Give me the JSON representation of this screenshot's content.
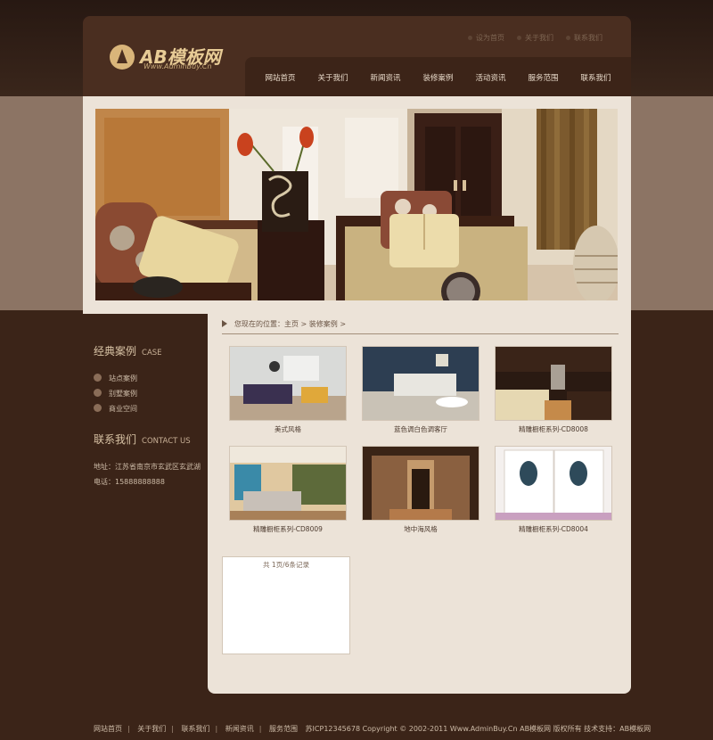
{
  "header": {
    "logo_title": "AB模板网",
    "logo_sub": "Www.AdminBuy.Cn",
    "top_links": [
      "设为首页",
      "关于我们",
      "联系我们"
    ]
  },
  "nav": {
    "items": [
      "网站首页",
      "关于我们",
      "新闻资讯",
      "装修案例",
      "活动资讯",
      "服务范围",
      "联系我们"
    ]
  },
  "sidebar": {
    "case_title": "经典案例",
    "case_title_en": "CASE",
    "case_items": [
      "站点案例",
      "别墅案例",
      "商业空间"
    ],
    "contact_title": "联系我们",
    "contact_title_en": "CONTACT US",
    "address": "地址：江苏省南京市玄武区玄武湖",
    "phone": "电话：15888888888"
  },
  "main": {
    "breadcrumb": "您现在的位置：主页 > 装修案例 >",
    "cases": [
      {
        "caption": "美式风格"
      },
      {
        "caption": "蓝色调白色调客厅"
      },
      {
        "caption": "精雕橱柜系列-CD8008"
      },
      {
        "caption": "精雕橱柜系列-CD8009"
      },
      {
        "caption": "地中海风格"
      },
      {
        "caption": "精雕橱柜系列-CD8004"
      }
    ],
    "empty_note": "共 1页/6条记录"
  },
  "footer": {
    "links": [
      "网站首页",
      "关于我们",
      "联系我们",
      "新闻资讯",
      "服务范围"
    ],
    "copyright": "苏ICP12345678  Copyright © 2002-2011 Www.AdminBuy.Cn AB模板网 版权所有  技术支持：AB模板网"
  },
  "colors": {
    "accent": "#d9b57a",
    "nav_bg": "#3c2418",
    "panel_bg": "#ece3d8"
  }
}
